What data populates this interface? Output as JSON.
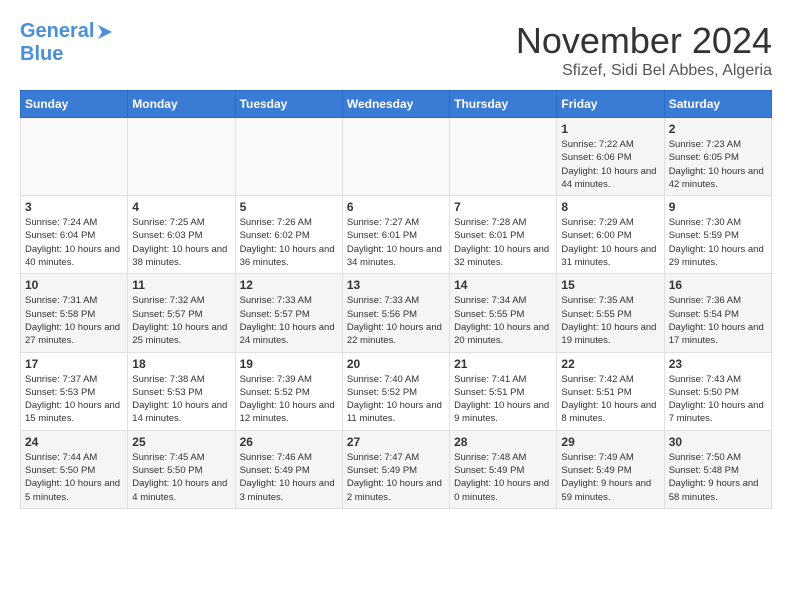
{
  "header": {
    "logo_line1": "General",
    "logo_line2": "Blue",
    "month_title": "November 2024",
    "location": "Sfizef, Sidi Bel Abbes, Algeria"
  },
  "weekdays": [
    "Sunday",
    "Monday",
    "Tuesday",
    "Wednesday",
    "Thursday",
    "Friday",
    "Saturday"
  ],
  "weeks": [
    [
      {
        "day": "",
        "info": ""
      },
      {
        "day": "",
        "info": ""
      },
      {
        "day": "",
        "info": ""
      },
      {
        "day": "",
        "info": ""
      },
      {
        "day": "",
        "info": ""
      },
      {
        "day": "1",
        "info": "Sunrise: 7:22 AM\nSunset: 6:06 PM\nDaylight: 10 hours and 44 minutes."
      },
      {
        "day": "2",
        "info": "Sunrise: 7:23 AM\nSunset: 6:05 PM\nDaylight: 10 hours and 42 minutes."
      }
    ],
    [
      {
        "day": "3",
        "info": "Sunrise: 7:24 AM\nSunset: 6:04 PM\nDaylight: 10 hours and 40 minutes."
      },
      {
        "day": "4",
        "info": "Sunrise: 7:25 AM\nSunset: 6:03 PM\nDaylight: 10 hours and 38 minutes."
      },
      {
        "day": "5",
        "info": "Sunrise: 7:26 AM\nSunset: 6:02 PM\nDaylight: 10 hours and 36 minutes."
      },
      {
        "day": "6",
        "info": "Sunrise: 7:27 AM\nSunset: 6:01 PM\nDaylight: 10 hours and 34 minutes."
      },
      {
        "day": "7",
        "info": "Sunrise: 7:28 AM\nSunset: 6:01 PM\nDaylight: 10 hours and 32 minutes."
      },
      {
        "day": "8",
        "info": "Sunrise: 7:29 AM\nSunset: 6:00 PM\nDaylight: 10 hours and 31 minutes."
      },
      {
        "day": "9",
        "info": "Sunrise: 7:30 AM\nSunset: 5:59 PM\nDaylight: 10 hours and 29 minutes."
      }
    ],
    [
      {
        "day": "10",
        "info": "Sunrise: 7:31 AM\nSunset: 5:58 PM\nDaylight: 10 hours and 27 minutes."
      },
      {
        "day": "11",
        "info": "Sunrise: 7:32 AM\nSunset: 5:57 PM\nDaylight: 10 hours and 25 minutes."
      },
      {
        "day": "12",
        "info": "Sunrise: 7:33 AM\nSunset: 5:57 PM\nDaylight: 10 hours and 24 minutes."
      },
      {
        "day": "13",
        "info": "Sunrise: 7:33 AM\nSunset: 5:56 PM\nDaylight: 10 hours and 22 minutes."
      },
      {
        "day": "14",
        "info": "Sunrise: 7:34 AM\nSunset: 5:55 PM\nDaylight: 10 hours and 20 minutes."
      },
      {
        "day": "15",
        "info": "Sunrise: 7:35 AM\nSunset: 5:55 PM\nDaylight: 10 hours and 19 minutes."
      },
      {
        "day": "16",
        "info": "Sunrise: 7:36 AM\nSunset: 5:54 PM\nDaylight: 10 hours and 17 minutes."
      }
    ],
    [
      {
        "day": "17",
        "info": "Sunrise: 7:37 AM\nSunset: 5:53 PM\nDaylight: 10 hours and 15 minutes."
      },
      {
        "day": "18",
        "info": "Sunrise: 7:38 AM\nSunset: 5:53 PM\nDaylight: 10 hours and 14 minutes."
      },
      {
        "day": "19",
        "info": "Sunrise: 7:39 AM\nSunset: 5:52 PM\nDaylight: 10 hours and 12 minutes."
      },
      {
        "day": "20",
        "info": "Sunrise: 7:40 AM\nSunset: 5:52 PM\nDaylight: 10 hours and 11 minutes."
      },
      {
        "day": "21",
        "info": "Sunrise: 7:41 AM\nSunset: 5:51 PM\nDaylight: 10 hours and 9 minutes."
      },
      {
        "day": "22",
        "info": "Sunrise: 7:42 AM\nSunset: 5:51 PM\nDaylight: 10 hours and 8 minutes."
      },
      {
        "day": "23",
        "info": "Sunrise: 7:43 AM\nSunset: 5:50 PM\nDaylight: 10 hours and 7 minutes."
      }
    ],
    [
      {
        "day": "24",
        "info": "Sunrise: 7:44 AM\nSunset: 5:50 PM\nDaylight: 10 hours and 5 minutes."
      },
      {
        "day": "25",
        "info": "Sunrise: 7:45 AM\nSunset: 5:50 PM\nDaylight: 10 hours and 4 minutes."
      },
      {
        "day": "26",
        "info": "Sunrise: 7:46 AM\nSunset: 5:49 PM\nDaylight: 10 hours and 3 minutes."
      },
      {
        "day": "27",
        "info": "Sunrise: 7:47 AM\nSunset: 5:49 PM\nDaylight: 10 hours and 2 minutes."
      },
      {
        "day": "28",
        "info": "Sunrise: 7:48 AM\nSunset: 5:49 PM\nDaylight: 10 hours and 0 minutes."
      },
      {
        "day": "29",
        "info": "Sunrise: 7:49 AM\nSunset: 5:49 PM\nDaylight: 9 hours and 59 minutes."
      },
      {
        "day": "30",
        "info": "Sunrise: 7:50 AM\nSunset: 5:48 PM\nDaylight: 9 hours and 58 minutes."
      }
    ]
  ]
}
